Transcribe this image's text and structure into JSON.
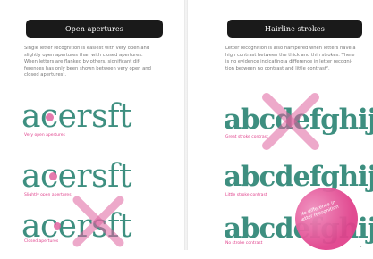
{
  "left_page": {
    "title": "Open apertures",
    "body": "Single letter recognition is easiest with very open and\nslightly open apertures than with closed apertures.\nWhen letters are flanked by others, significant dif-\nferences has only been shown between very open and\nclosed apertures¹.",
    "specimens": [
      {
        "text": "acersft",
        "caption": "Very open apertures"
      },
      {
        "text": "acersft",
        "caption": "Slightly open apertures"
      },
      {
        "text": "acersft",
        "caption": "Closed apertures"
      }
    ]
  },
  "right_page": {
    "title": "Hairline strokes",
    "body": "Letter recognition is also hampered when letters have a\nhigh contrast between the thick and thin strokes. There\nis no evidence indicating a difference in letter recogni-\ntion between no contrast and little contrast².",
    "specimens": [
      {
        "text": "abcdefghij",
        "caption": "Great stroke contrast"
      },
      {
        "text": "abcdefghij",
        "caption": "Little stroke contrast"
      },
      {
        "text": "abcdefghij",
        "caption": "No stroke contrast"
      }
    ],
    "badge": "No difference in letter recognition"
  },
  "colors": {
    "specimen": "#3e8f80",
    "accent": "#e0428c",
    "header": "#1a1a1a"
  }
}
